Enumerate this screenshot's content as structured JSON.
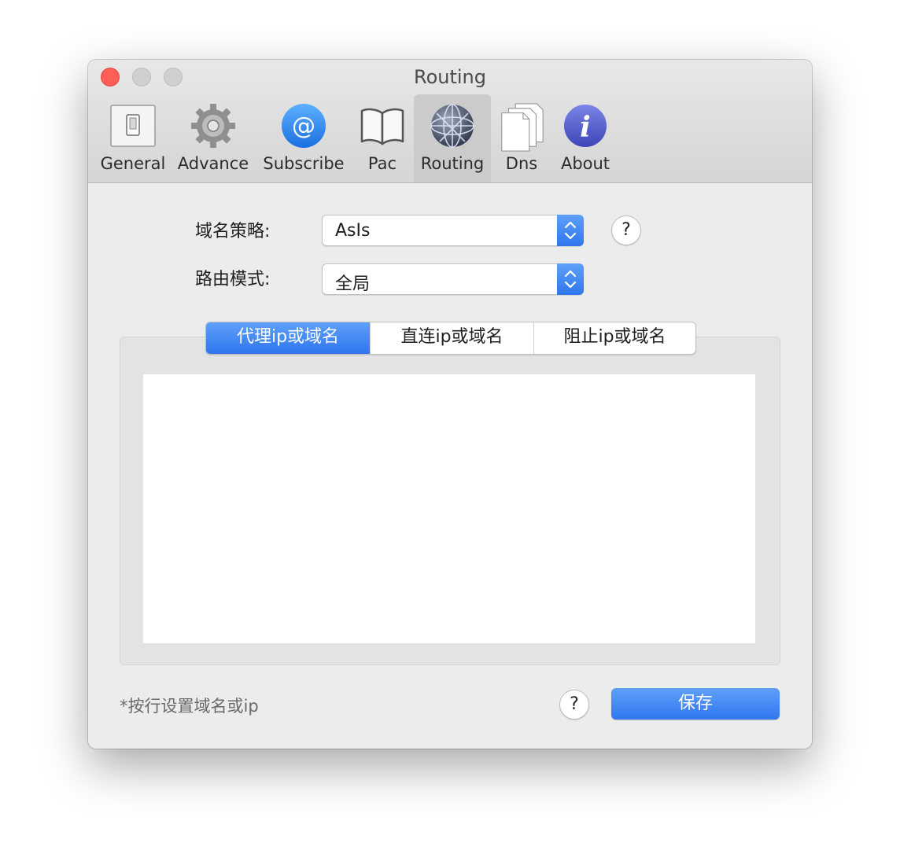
{
  "window": {
    "title": "Routing"
  },
  "toolbar": {
    "items": [
      {
        "label": "General",
        "icon": "switch-icon"
      },
      {
        "label": "Advance",
        "icon": "gear-icon"
      },
      {
        "label": "Subscribe",
        "icon": "at-sign-icon"
      },
      {
        "label": "Pac",
        "icon": "book-icon"
      },
      {
        "label": "Routing",
        "icon": "network-globe-icon",
        "selected": true
      },
      {
        "label": "Dns",
        "icon": "documents-icon"
      },
      {
        "label": "About",
        "icon": "info-icon"
      }
    ]
  },
  "form": {
    "domain_strategy": {
      "label": "域名策略:",
      "value": "AsIs",
      "help": "?"
    },
    "routing_mode": {
      "label": "路由模式:",
      "value": "全局"
    }
  },
  "tabs": [
    {
      "label": "代理ip或域名",
      "selected": true
    },
    {
      "label": "直连ip或域名",
      "selected": false
    },
    {
      "label": "阻止ip或域名",
      "selected": false
    }
  ],
  "editor": {
    "value": ""
  },
  "footer": {
    "hint": "*按行设置域名或ip",
    "help": "?",
    "save_label": "保存"
  },
  "colors": {
    "accent": "#3b82f6",
    "close": "#fe5f57",
    "inactive_traffic": "#d0d0d0"
  }
}
